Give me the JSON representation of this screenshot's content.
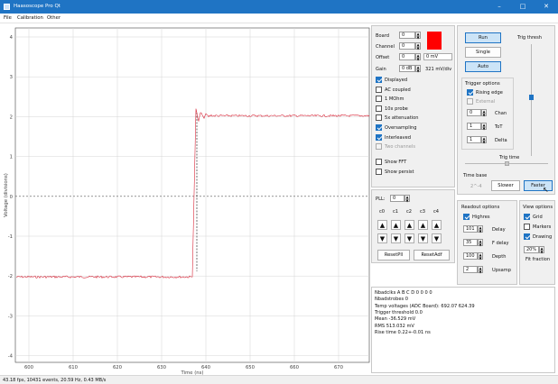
{
  "window": {
    "title": "Haasoscope Pro Qt"
  },
  "menu": [
    "File",
    "Calibration",
    "Other"
  ],
  "plot": {
    "xlabel": "Time (ns)",
    "ylabel": "Voltage (divisions)",
    "xticks": [
      "600",
      "610",
      "620",
      "630",
      "640",
      "650",
      "660",
      "670"
    ],
    "yticks": [
      "4",
      "3",
      "2",
      "1",
      "0",
      "-1",
      "-2",
      "-3",
      "-4"
    ],
    "trace_color": "#d8283a"
  },
  "channel": {
    "board_label": "Board",
    "board_value": "0",
    "channel_label": "Channel",
    "channel_value": "0",
    "offset_label": "Offset",
    "offset_value": "0",
    "offset_unit": "0 mV",
    "gain_label": "Gain",
    "gain_value": "0 dB",
    "gain_unit": "321 mV/div",
    "color": "#ff0000",
    "options": [
      {
        "label": "Displayed",
        "checked": true,
        "disabled": false
      },
      {
        "label": "AC coupled",
        "checked": false,
        "disabled": false
      },
      {
        "label": "1 MOhm",
        "checked": false,
        "disabled": false
      },
      {
        "label": "10x probe",
        "checked": false,
        "disabled": false
      },
      {
        "label": "5x attenuation",
        "checked": false,
        "disabled": false
      },
      {
        "label": "Oversampling",
        "checked": true,
        "disabled": false
      },
      {
        "label": "Interleaved",
        "checked": true,
        "disabled": false
      },
      {
        "label": "Two channels",
        "checked": false,
        "disabled": true
      }
    ],
    "fft": [
      {
        "label": "Show FFT",
        "checked": false
      },
      {
        "label": "Show persist",
        "checked": false
      }
    ]
  },
  "pll": {
    "label": "PLL:",
    "value": "0",
    "cols": [
      "c0",
      "c1",
      "c2",
      "c3",
      "c4"
    ],
    "reset_pll": "ResetPll",
    "reset_adf": "ResetAdf"
  },
  "acquisition": {
    "run": "Run",
    "single": "Single",
    "auto": "Auto",
    "trig_thresh": "Trig thresh",
    "trigger_options_title": "Trigger options",
    "rising_edge": "Rising edge",
    "external": "External",
    "chan_label": "Chan",
    "chan_value": "0",
    "tot_label": "ToT",
    "tot_value": "1",
    "delta_label": "Delta",
    "delta_value": "1",
    "trig_time": "Trig time",
    "timebase_title": "Time base",
    "timebase_value": "2^-4",
    "slower": "Slower",
    "faster": "Faster"
  },
  "readout": {
    "title": "Readout options",
    "highres": "Highres",
    "delay_label": "Delay",
    "delay_value": "101",
    "fdelay_label": "F delay",
    "fdelay_value": "35",
    "depth_label": "Depth",
    "depth_value": "100",
    "upsamp_label": "Upsamp",
    "upsamp_value": "2"
  },
  "view": {
    "title": "View options",
    "grid": "Grid",
    "markers": "Markers",
    "drawing": "Drawing",
    "fit_value": "20%",
    "fit_label": "Fit fraction"
  },
  "info": [
    "Nbadclks A B C D 0 0 0 0",
    "Nbadstrobes 0",
    "Temp voltages (ADC Board): 692.07 624.39",
    "Trigger threshold 0.0",
    "Mean -36.529 mV",
    "RMS 513.032 mV",
    "Rise time 0.22+-0.01 ns"
  ],
  "status": "43.18 fps, 10431 events, 20.59 Hz, 0.43 MB/s"
}
